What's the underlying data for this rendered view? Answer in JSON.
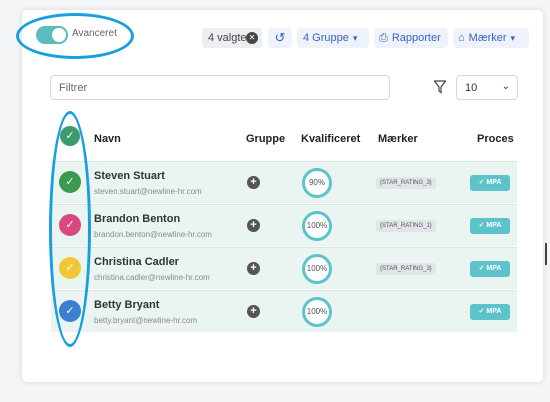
{
  "toolbar": {
    "toggle_label": "Avanceret",
    "selected_label": "4 valgte",
    "clear_icon": "close-circle-icon",
    "reset_icon": "undo-icon",
    "group_label": "4 Gruppe",
    "reports_label": "Rapporter",
    "marks_label": "Mærker"
  },
  "filter": {
    "placeholder": "Filtrer",
    "page_size": "10"
  },
  "table": {
    "columns": [
      "Navn",
      "Gruppe",
      "Kvalificeret",
      "Mærker",
      "Proces"
    ],
    "rows": [
      {
        "name": "Steven Stuart",
        "email": "steven.stuart@newline-hr.com",
        "qualified": "90%",
        "tag": "{STAR_RATING_3}",
        "process": "MPA",
        "check_color": "#3c9a4e"
      },
      {
        "name": "Brandon Benton",
        "email": "brandon.benton@newline-hr.com",
        "qualified": "100%",
        "tag": "{STAR_RATING_1}",
        "process": "MPA",
        "check_color": "#d9487e"
      },
      {
        "name": "Christina Cadler",
        "email": "christina.cadler@newline-hr.com",
        "qualified": "100%",
        "tag": "{STAR_RATING_3}",
        "process": "MPA",
        "check_color": "#f2c736"
      },
      {
        "name": "Betty Bryant",
        "email": "betty.bryant@newline-hr.com",
        "qualified": "100%",
        "tag": "",
        "process": "MPA",
        "check_color": "#3b7fd0"
      }
    ]
  },
  "colors": {
    "accent": "#5bc3c9",
    "row_bg": "#eaf5f2",
    "link_blue": "#3a63c8",
    "annotation": "#1a9ee0"
  }
}
